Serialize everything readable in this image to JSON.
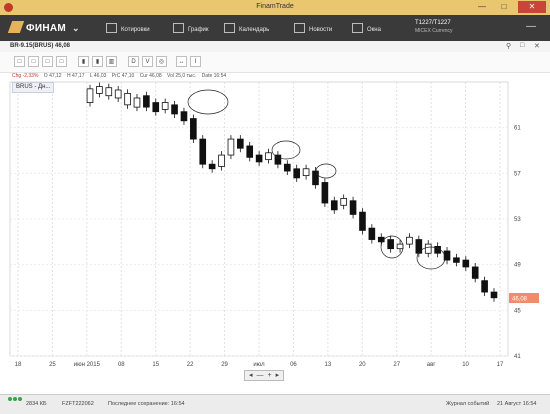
{
  "window": {
    "title": "FinamTrade",
    "min_label": "—",
    "max_label": "□",
    "close_label": "✕"
  },
  "appbar": {
    "brand": "ФИНАМ",
    "menu": [
      {
        "label": "Котировки",
        "icon": "quotes-icon"
      },
      {
        "label": "График",
        "icon": "chart-icon"
      },
      {
        "label": "Календарь",
        "icon": "calendar-icon"
      },
      {
        "label": "Новости",
        "icon": "news-icon"
      },
      {
        "label": "Окна",
        "icon": "windows-icon"
      }
    ],
    "instrument": {
      "code": "T1227/T1227",
      "exchange": "MICEX Currency"
    }
  },
  "panel": {
    "title": "BR-9.15(BRUS) 46,08",
    "controls": [
      "⚲",
      "□",
      "✕"
    ]
  },
  "toolbar": {
    "buttons": [
      "□",
      "□",
      "□",
      "□",
      "▮",
      "▮",
      "▥",
      "D",
      "V",
      "◎",
      "↔",
      "I"
    ]
  },
  "info": {
    "chg": "Chg -2,33%",
    "o": "O 47,12",
    "h": "H 47,17",
    "l": "L 46,03",
    "prc": "PrC 47,10",
    "cur": "Cur 46,08",
    "vol": "Vol 25,0 тыс.",
    "date": "Date 16:54"
  },
  "legend": {
    "label": "BRUS - Дн..."
  },
  "chart_data": {
    "type": "candlestick",
    "y_ticks": [
      "61",
      "57",
      "53",
      "49",
      "45",
      "41"
    ],
    "x_ticks": [
      "18",
      "25",
      "июн 2015",
      "08",
      "15",
      "22",
      "29",
      "июл",
      "06",
      "13",
      "20",
      "27",
      "авг",
      "10",
      "17"
    ],
    "last_price_label": "46,08",
    "ylim": [
      41,
      65
    ],
    "candles": [
      {
        "o": 63.2,
        "c": 64.4
      },
      {
        "o": 64.0,
        "c": 64.6
      },
      {
        "o": 63.8,
        "c": 64.5
      },
      {
        "o": 63.6,
        "c": 64.3
      },
      {
        "o": 63.0,
        "c": 64.0
      },
      {
        "o": 62.8,
        "c": 63.6
      },
      {
        "o": 63.8,
        "c": 62.8
      },
      {
        "o": 63.2,
        "c": 62.4
      },
      {
        "o": 62.6,
        "c": 63.2
      },
      {
        "o": 63.0,
        "c": 62.2
      },
      {
        "o": 62.4,
        "c": 61.6
      },
      {
        "o": 61.8,
        "c": 60.0
      },
      {
        "o": 60.0,
        "c": 57.8
      },
      {
        "o": 57.8,
        "c": 57.4
      },
      {
        "o": 57.6,
        "c": 58.6
      },
      {
        "o": 58.6,
        "c": 60.0
      },
      {
        "o": 60.0,
        "c": 59.2
      },
      {
        "o": 59.4,
        "c": 58.4
      },
      {
        "o": 58.6,
        "c": 58.0
      },
      {
        "o": 58.2,
        "c": 58.8
      },
      {
        "o": 58.6,
        "c": 57.8
      },
      {
        "o": 57.8,
        "c": 57.2
      },
      {
        "o": 57.4,
        "c": 56.6
      },
      {
        "o": 56.8,
        "c": 57.4
      },
      {
        "o": 57.2,
        "c": 56.0
      },
      {
        "o": 56.2,
        "c": 54.4
      },
      {
        "o": 54.6,
        "c": 53.8
      },
      {
        "o": 54.2,
        "c": 54.8
      },
      {
        "o": 54.6,
        "c": 53.4
      },
      {
        "o": 53.6,
        "c": 52.0
      },
      {
        "o": 52.2,
        "c": 51.2
      },
      {
        "o": 51.4,
        "c": 51.0
      },
      {
        "o": 51.2,
        "c": 50.4
      },
      {
        "o": 50.4,
        "c": 50.8
      },
      {
        "o": 50.8,
        "c": 51.4
      },
      {
        "o": 51.2,
        "c": 50.0
      },
      {
        "o": 50.0,
        "c": 50.8
      },
      {
        "o": 50.6,
        "c": 50.0
      },
      {
        "o": 50.2,
        "c": 49.4
      },
      {
        "o": 49.6,
        "c": 49.2
      },
      {
        "o": 49.4,
        "c": 48.8
      },
      {
        "o": 48.8,
        "c": 47.8
      },
      {
        "o": 47.6,
        "c": 46.6
      },
      {
        "o": 46.6,
        "c": 46.1
      }
    ]
  },
  "zoombar": {
    "buttons": [
      "◂",
      "—",
      "+",
      "▸"
    ]
  },
  "status": {
    "size": "2834 КБ",
    "account": "FZFT222062",
    "saved": "Последнее сохранение: 16:54",
    "journal": "Журнал событий",
    "datetime": "21 Август 16:54"
  }
}
